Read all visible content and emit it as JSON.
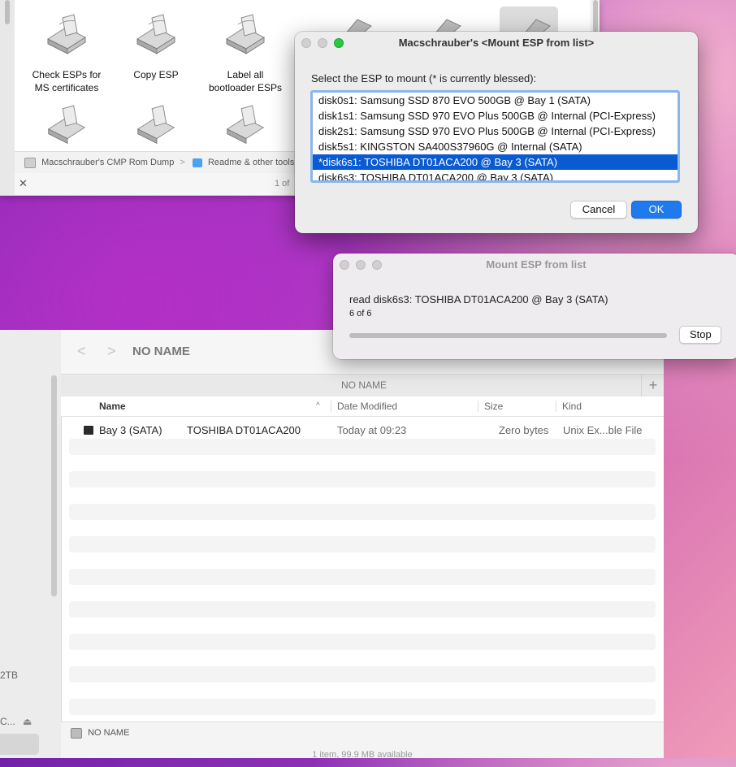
{
  "finder_top": {
    "icons_row1": [
      "Check ESPs for MS certificates",
      "Copy ESP",
      "Label all bootloader ESPs"
    ],
    "path": [
      "Macschrauber's CMP Rom Dump",
      "Readme & other tools"
    ],
    "path_separator": ">",
    "status_fragment": "1 of",
    "close_glyph": "✕"
  },
  "dialog": {
    "title": "Macschrauber's <Mount ESP from list>",
    "prompt": "Select the ESP to mount (* is currently blessed):",
    "items": [
      "disk0s1: Samsung SSD 870 EVO 500GB @ Bay 1 (SATA)",
      "disk1s1: Samsung SSD 970 EVO Plus 500GB @ Internal (PCI-Express)",
      "disk2s1: Samsung SSD 970 EVO Plus 500GB @ Internal (PCI-Express)",
      "disk5s1: KINGSTON SA400S37960G @ Internal (SATA)",
      "*disk6s1: TOSHIBA DT01ACA200 @ Bay 3 (SATA)",
      "disk6s3: TOSHIBA DT01ACA200 @ Bay 3 (SATA)"
    ],
    "selected_index": 4,
    "cancel_label": "Cancel",
    "ok_label": "OK",
    "colors": {
      "close": "#fe5f57",
      "minimize": "#febc2e",
      "zoom": "#28c840",
      "selection": "#0a5bd3",
      "accent": "#1f7aee"
    }
  },
  "progress_window": {
    "title": "Mount ESP from list",
    "message": "read disk6s3: TOSHIBA DT01ACA200 @ Bay 3 (SATA)",
    "count": "6 of 6",
    "progress_fraction": 1.0,
    "stop_label": "Stop"
  },
  "finder_bottom": {
    "title": "NO NAME",
    "tab_title": "NO NAME",
    "add_tab_glyph": "+",
    "columns": {
      "name": "Name",
      "date": "Date Modified",
      "size": "Size",
      "kind": "Kind"
    },
    "sort_glyph": "^",
    "rows": [
      {
        "name": "Bay 3 (SATA)",
        "name_extra": "TOSHIBA DT01ACA200",
        "date": "Today at 09:23",
        "size": "Zero bytes",
        "kind": "Unix Ex...ble File"
      }
    ],
    "path_item": "NO NAME",
    "status": "1 item, 99.9 MB available",
    "sidebar_texts": {
      "capacity": "2TB",
      "truncated": "C..."
    },
    "eject_glyph": "⏏",
    "back_glyph": "<",
    "forward_glyph": ">"
  }
}
